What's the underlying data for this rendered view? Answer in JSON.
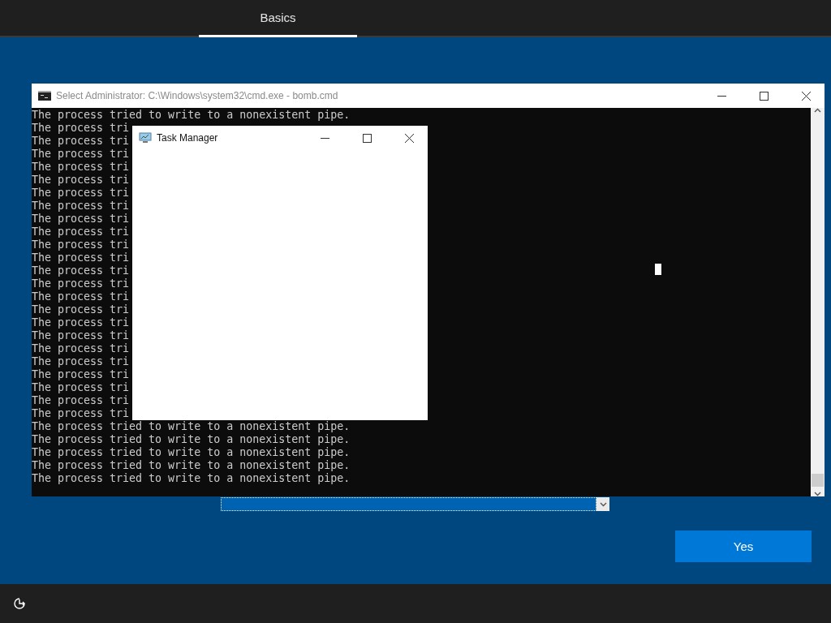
{
  "header": {
    "tabs": [
      {
        "label": "Basics",
        "selected": true
      }
    ]
  },
  "console_window": {
    "title": "Select Administrator: C:\\Windows\\system32\\cmd.exe - bomb.cmd",
    "lines": [
      "The process tried to write to a nonexistent pipe.",
      "The process tri",
      "The process tri",
      "The process tri",
      "The process tri",
      "The process tri",
      "The process tri",
      "The process tri",
      "The process tri",
      "The process tri",
      "The process tri",
      "The process tri",
      "The process tri",
      "The process tri",
      "The process tri",
      "The process tri",
      "The process tri",
      "The process tri",
      "The process tri",
      "The process tri",
      "The process tri",
      "The process tri",
      "The process tri",
      "The process tri",
      "The process tried to write to a nonexistent pipe.",
      "The process tried to write to a nonexistent pipe.",
      "The process tried to write to a nonexistent pipe.",
      "The process tried to write to a nonexistent pipe.",
      "The process tried to write to a nonexistent pipe."
    ]
  },
  "task_manager": {
    "title": "Task Manager"
  },
  "buttons": [
    {
      "label": "Yes"
    }
  ]
}
